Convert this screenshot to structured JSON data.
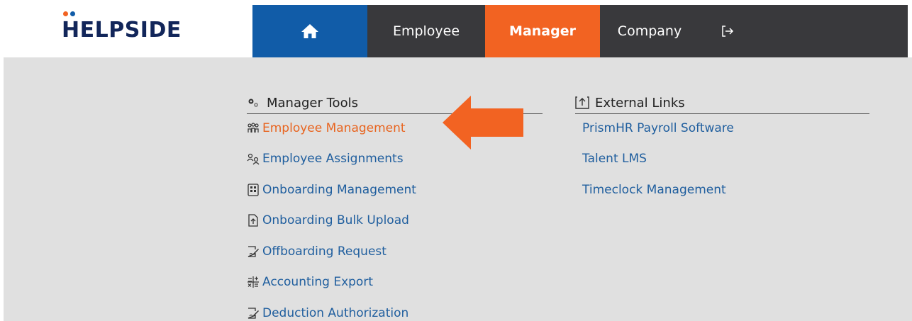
{
  "brand": {
    "name": "HELPSIDE",
    "dot_colors": [
      "#f26322",
      "#115ca8"
    ]
  },
  "nav": {
    "home_icon": "home-icon",
    "items": [
      {
        "label": "Employee"
      },
      {
        "label": "Manager",
        "active": true
      },
      {
        "label": "Company"
      }
    ],
    "logout_icon": "logout-icon"
  },
  "manager_tools": {
    "title": "Manager Tools",
    "icon": "gears-icon",
    "links": [
      {
        "label": "Employee Management",
        "icon": "people-group-icon",
        "active": true
      },
      {
        "label": "Employee Assignments",
        "icon": "user-assign-icon"
      },
      {
        "label": "Onboarding Management",
        "icon": "id-card-icon"
      },
      {
        "label": "Onboarding Bulk Upload",
        "icon": "file-upload-icon"
      },
      {
        "label": "Offboarding Request",
        "icon": "signature-icon"
      },
      {
        "label": "Accounting Export",
        "icon": "calculator-icon"
      },
      {
        "label": "Deduction Authorization",
        "icon": "signature-icon"
      }
    ]
  },
  "external_links": {
    "title": "External Links",
    "icon": "upload-box-icon",
    "links": [
      {
        "label": "PrismHR Payroll Software"
      },
      {
        "label": "Talent LMS"
      },
      {
        "label": "Timeclock Management"
      }
    ]
  },
  "colors": {
    "accent_orange": "#f26322",
    "brand_blue": "#115ca8",
    "nav_dark": "#39393c",
    "link_blue": "#1f5e9e"
  }
}
